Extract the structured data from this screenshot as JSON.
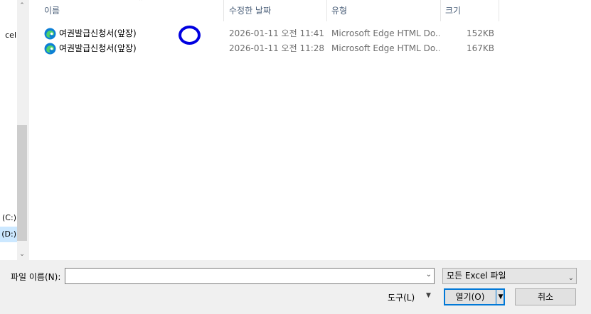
{
  "nav": {
    "items": [
      {
        "label": "cel",
        "selected": false
      },
      {
        "label": "(C:)",
        "selected": false
      },
      {
        "label": "(D:)",
        "selected": true
      }
    ]
  },
  "columns": {
    "name": "이름",
    "date": "수정한 날짜",
    "type": "유형",
    "size": "크기"
  },
  "files": [
    {
      "name": "여권발급신청서(앞장)",
      "date": "2026-01-11 오전 11:41",
      "type": "Microsoft Edge HTML Do...",
      "size": "152KB"
    },
    {
      "name": "여권발급신청서(앞장)",
      "date": "2026-01-11 오전 11:28",
      "type": "Microsoft Edge HTML Do...",
      "size": "167KB"
    }
  ],
  "footer": {
    "filename_label": "파일 이름(N):",
    "filename_value": "",
    "filter_value": "모든 Excel 파일",
    "tools_label": "도구(L)",
    "open_label": "열기(O)",
    "cancel_label": "취소"
  },
  "colors": {
    "selection": "#cce8ff",
    "accent": "#0078d7",
    "marker": "#0000e0"
  },
  "icons": {
    "file_icon": "edge-icon"
  }
}
